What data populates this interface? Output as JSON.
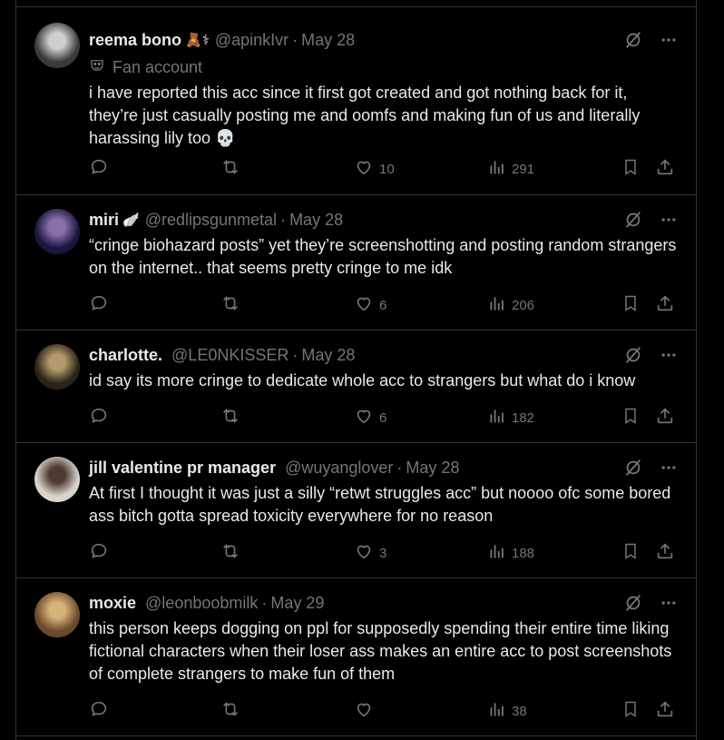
{
  "posts": [
    {
      "name": "reema bono",
      "badges": "🧸⚕",
      "handle": "@apinkIvr",
      "date": "May 28",
      "label": "Fan account",
      "label_icon": "theater-mask-icon",
      "text": "i have reported this acc since it first got created and got nothing back for it, they’re just casually posting me and oomfs and making fun of us and literally harassing lily too 💀",
      "replies": "",
      "reposts": "",
      "likes": "10",
      "views": "291",
      "avatar_colors": [
        "#3a3a3a",
        "#cfcfcf"
      ]
    },
    {
      "name": "miri",
      "badges": "🪽",
      "handle": "@redlipsgunmetal",
      "date": "May 28",
      "text": "“cringe biohazard posts” yet they’re screenshotting and posting random strangers on the internet.. that seems pretty cringe to me idk",
      "replies": "",
      "reposts": "",
      "likes": "6",
      "views": "206",
      "avatar_colors": [
        "#1a1640",
        "#8a6fa8"
      ]
    },
    {
      "name": "charlotte.",
      "badges": "",
      "handle": "@LE0NKISSER",
      "date": "May 28",
      "text": "id say its more cringe to dedicate whole acc to strangers but what do i know",
      "replies": "",
      "reposts": "",
      "likes": "6",
      "views": "182",
      "avatar_colors": [
        "#2a2418",
        "#b39a6a"
      ]
    },
    {
      "name": "jill valentine pr manager",
      "badges": "",
      "handle": "@wuyanglover",
      "date": "May 28",
      "text": "At first I thought it was just a silly “retwt struggles acc” but noooo ofc some bored ass bitch gotta spread toxicity everywhere for no reason",
      "replies": "",
      "reposts": "",
      "likes": "3",
      "views": "188",
      "avatar_colors": [
        "#d9d4cc",
        "#4a3a30"
      ]
    },
    {
      "name": "moxie",
      "badges": "",
      "handle": "@leonboobmilk",
      "date": "May 29",
      "text": "this person keeps dogging on ppl for supposedly spending their entire time liking fictional characters when their loser ass makes an entire acc to post screenshots of complete strangers to make fun of them",
      "replies": "",
      "reposts": "",
      "likes": "",
      "views": "38",
      "avatar_colors": [
        "#6b4a2a",
        "#d7b27a"
      ]
    }
  ],
  "colors": {
    "background": "#000000",
    "text": "#e7e9ea",
    "muted": "#71767b",
    "border": "#2f3336"
  }
}
